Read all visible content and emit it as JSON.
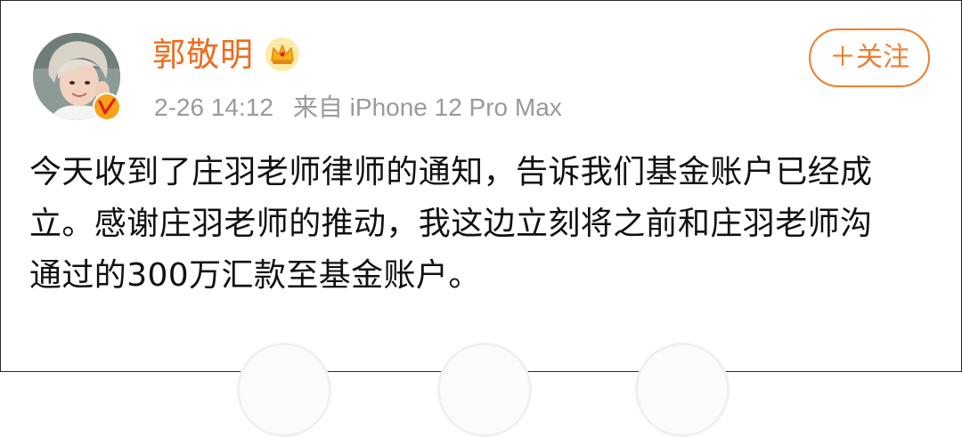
{
  "user": {
    "name": "郭敬明",
    "crown_icon": "crown-icon",
    "verified_icon": "orange-v-verified-icon"
  },
  "meta": {
    "time": "2-26 14:12",
    "source": "来自 iPhone 12 Pro Max"
  },
  "follow_button": {
    "label": "＋关注"
  },
  "post": {
    "lines": [
      "今天收到了庄羽老师律师的通知，告诉我们基金账户已经成",
      "立。感谢庄羽老师的推动，我这边立刻将之前和庄羽老师沟",
      "通过的300万汇款至基金账户。"
    ]
  },
  "colors": {
    "name": "#ef6b1e",
    "follow": "#ef7d2e",
    "meta": "#9a9a9a",
    "text": "#111111"
  }
}
